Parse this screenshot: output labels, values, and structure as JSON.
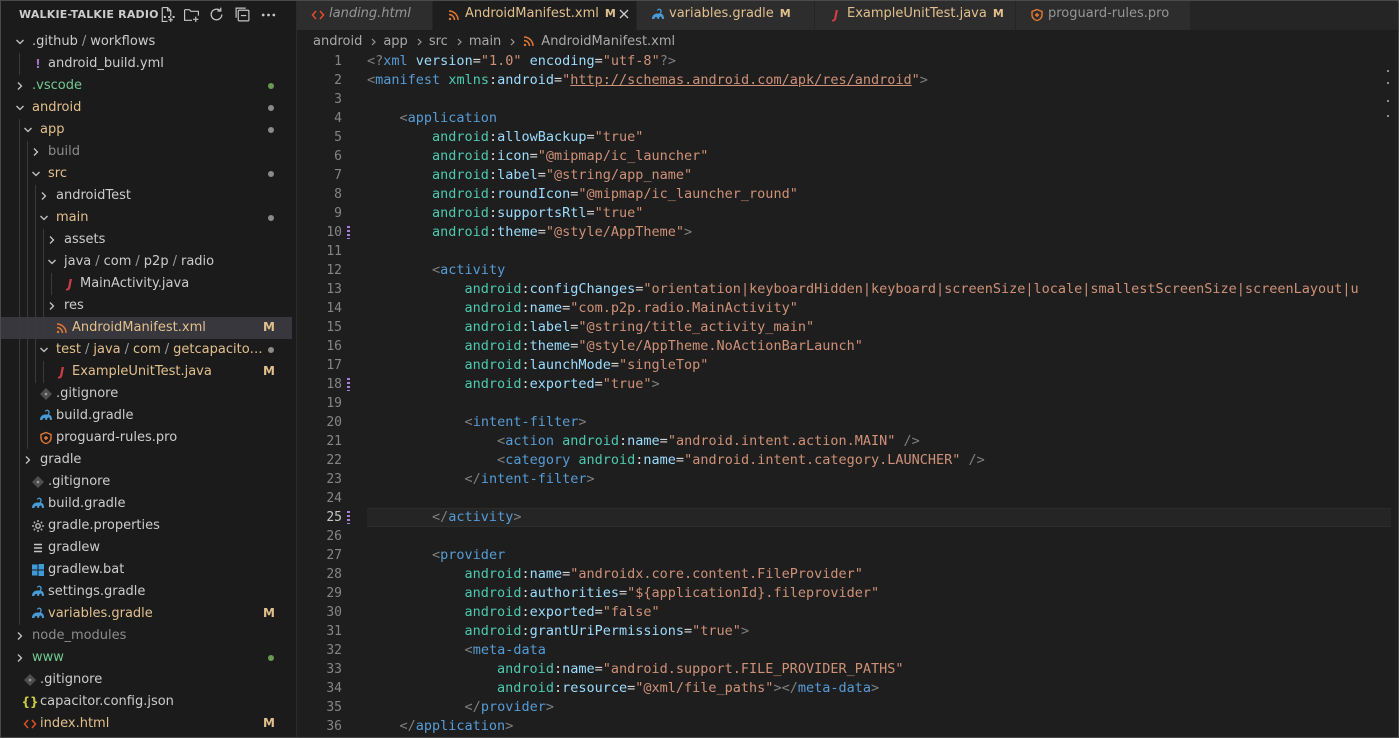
{
  "colors": {
    "tree_default": "#cccccc",
    "tree_modified": "#e2c08d",
    "tree_untracked": "#73c991",
    "tree_ignored": "#8c8c8c",
    "dot_green": "#6a9955",
    "dot_gray": "#8a8a8a",
    "yaml_icon": "#a074c4",
    "java_icon": "#cc3e44",
    "xml_icon": "#e37933",
    "gradle_icon": "#4a9ad6",
    "json_icon": "#cbcb41",
    "html_icon": "#e44d26"
  },
  "sidebar": {
    "title": "WALKIE-TALKIE RADIO ...",
    "actions": [
      {
        "name": "new-file-icon"
      },
      {
        "name": "new-folder-icon"
      },
      {
        "name": "refresh-icon"
      },
      {
        "name": "collapse-all-icon"
      },
      {
        "name": "more-actions-icon"
      }
    ],
    "tree": [
      {
        "parts": [
          ".github",
          "workflows"
        ],
        "depth": 0,
        "chevron": "down",
        "icon": "none",
        "color": "default"
      },
      {
        "parts": [
          "android_build.yml"
        ],
        "depth": 1,
        "chevron": "none",
        "icon": "yaml",
        "glyph": "!",
        "color": "default"
      },
      {
        "parts": [
          ".vscode"
        ],
        "depth": 0,
        "chevron": "right",
        "icon": "none",
        "color": "untracked",
        "dot": "green"
      },
      {
        "parts": [
          "android"
        ],
        "depth": 0,
        "chevron": "down",
        "icon": "none",
        "color": "modified",
        "dot": "gray"
      },
      {
        "parts": [
          "app"
        ],
        "depth": 1,
        "chevron": "down",
        "icon": "none",
        "color": "modified",
        "dot": "gray"
      },
      {
        "parts": [
          "build"
        ],
        "depth": 2,
        "chevron": "right",
        "icon": "none",
        "color": "ignored"
      },
      {
        "parts": [
          "src"
        ],
        "depth": 2,
        "chevron": "down",
        "icon": "none",
        "color": "modified",
        "dot": "gray"
      },
      {
        "parts": [
          "androidTest"
        ],
        "depth": 3,
        "chevron": "right",
        "icon": "none",
        "color": "default"
      },
      {
        "parts": [
          "main"
        ],
        "depth": 3,
        "chevron": "down",
        "icon": "none",
        "color": "modified",
        "dot": "gray"
      },
      {
        "parts": [
          "assets"
        ],
        "depth": 4,
        "chevron": "right",
        "icon": "none",
        "color": "default"
      },
      {
        "parts": [
          "java",
          "com",
          "p2p",
          "radio"
        ],
        "depth": 4,
        "chevron": "down",
        "icon": "none",
        "color": "default"
      },
      {
        "parts": [
          "MainActivity.java"
        ],
        "depth": 5,
        "chevron": "none",
        "icon": "java",
        "glyph": "J",
        "color": "default"
      },
      {
        "parts": [
          "res"
        ],
        "depth": 4,
        "chevron": "right",
        "icon": "none",
        "color": "default"
      },
      {
        "parts": [
          "AndroidManifest.xml"
        ],
        "depth": 4,
        "chevron": "none",
        "icon": "xml",
        "color": "modified",
        "badge": "M",
        "selected": true
      },
      {
        "parts": [
          "test",
          "java",
          "com",
          "getcapacitor",
          "..."
        ],
        "depth": 3,
        "chevron": "down",
        "icon": "none",
        "color": "modified",
        "dot": "gray"
      },
      {
        "parts": [
          "ExampleUnitTest.java"
        ],
        "depth": 4,
        "chevron": "none",
        "icon": "java",
        "glyph": "J",
        "color": "modified",
        "badge": "M"
      },
      {
        "parts": [
          ".gitignore"
        ],
        "depth": 2,
        "chevron": "none",
        "icon": "git",
        "color": "default"
      },
      {
        "parts": [
          "build.gradle"
        ],
        "depth": 2,
        "chevron": "none",
        "icon": "gradle",
        "color": "default"
      },
      {
        "parts": [
          "proguard-rules.pro"
        ],
        "depth": 2,
        "chevron": "none",
        "icon": "proguard",
        "color": "default"
      },
      {
        "parts": [
          "gradle"
        ],
        "depth": 1,
        "chevron": "right",
        "icon": "none",
        "color": "default"
      },
      {
        "parts": [
          ".gitignore"
        ],
        "depth": 1,
        "chevron": "none",
        "icon": "git",
        "color": "default"
      },
      {
        "parts": [
          "build.gradle"
        ],
        "depth": 1,
        "chevron": "none",
        "icon": "gradle",
        "color": "default"
      },
      {
        "parts": [
          "gradle.properties"
        ],
        "depth": 1,
        "chevron": "none",
        "icon": "gear",
        "color": "default"
      },
      {
        "parts": [
          "gradlew"
        ],
        "depth": 1,
        "chevron": "none",
        "icon": "lines",
        "color": "default"
      },
      {
        "parts": [
          "gradlew.bat"
        ],
        "depth": 1,
        "chevron": "none",
        "icon": "windows",
        "color": "default"
      },
      {
        "parts": [
          "settings.gradle"
        ],
        "depth": 1,
        "chevron": "none",
        "icon": "gradle",
        "color": "default"
      },
      {
        "parts": [
          "variables.gradle"
        ],
        "depth": 1,
        "chevron": "none",
        "icon": "gradle",
        "color": "modified",
        "badge": "M"
      },
      {
        "parts": [
          "node_modules"
        ],
        "depth": 0,
        "chevron": "right",
        "icon": "none",
        "color": "ignored"
      },
      {
        "parts": [
          "www"
        ],
        "depth": 0,
        "chevron": "right",
        "icon": "none",
        "color": "untracked",
        "dot": "green"
      },
      {
        "parts": [
          ".gitignore"
        ],
        "depth": 0,
        "chevron": "none",
        "icon": "git",
        "color": "default"
      },
      {
        "parts": [
          "capacitor.config.json"
        ],
        "depth": 0,
        "chevron": "none",
        "icon": "json",
        "glyph": "{}",
        "color": "default"
      },
      {
        "parts": [
          "index.html"
        ],
        "depth": 0,
        "chevron": "none",
        "icon": "html",
        "color": "modified",
        "badge": "M"
      }
    ]
  },
  "tabs": [
    {
      "label": "landing.html",
      "icon": "html",
      "italic": true,
      "color": "#969696",
      "width": 136
    },
    {
      "label": "AndroidManifest.xml",
      "icon": "xml",
      "badge": "M",
      "active": true,
      "color": "#e2c08d",
      "width": 204
    },
    {
      "label": "variables.gradle",
      "icon": "gradle",
      "badge": "M",
      "color": "#e2c08d",
      "width": 178
    },
    {
      "label": "ExampleUnitTest.java",
      "icon": "java",
      "badge": "M",
      "color": "#e2c08d",
      "width": 201
    },
    {
      "label": "proguard-rules.pro",
      "icon": "proguard",
      "color": "#969696",
      "width": 175
    }
  ],
  "breadcrumb": [
    "android",
    "app",
    "src",
    "main",
    "AndroidManifest.xml"
  ],
  "editor": {
    "current_line": 25,
    "modified_lines": [
      10,
      18,
      25
    ],
    "lines": [
      [
        [
          "ta",
          "<?"
        ],
        [
          "tn",
          "xml"
        ],
        [
          "pl",
          " "
        ],
        [
          "an",
          "version"
        ],
        [
          "eq",
          "="
        ],
        [
          "av",
          "\"1.0\""
        ],
        [
          "pl",
          " "
        ],
        [
          "an",
          "encoding"
        ],
        [
          "eq",
          "="
        ],
        [
          "av",
          "\"utf-8\""
        ],
        [
          "ta",
          "?>"
        ]
      ],
      [
        [
          "ta",
          "<"
        ],
        [
          "tn",
          "manifest"
        ],
        [
          "pl",
          " "
        ],
        [
          "ns",
          "xmlns"
        ],
        [
          "eq",
          ":"
        ],
        [
          "an",
          "android"
        ],
        [
          "eq",
          "="
        ],
        [
          "av",
          "\""
        ],
        [
          "url",
          "http://schemas.android.com/apk/res/android"
        ],
        [
          "av",
          "\""
        ],
        [
          "ta",
          ">"
        ]
      ],
      [],
      [
        [
          "pl",
          "    "
        ],
        [
          "ta",
          "<"
        ],
        [
          "tn",
          "application"
        ]
      ],
      [
        [
          "pl",
          "        "
        ],
        [
          "ns",
          "android"
        ],
        [
          "eq",
          ":"
        ],
        [
          "an",
          "allowBackup"
        ],
        [
          "eq",
          "="
        ],
        [
          "av",
          "\"true\""
        ]
      ],
      [
        [
          "pl",
          "        "
        ],
        [
          "ns",
          "android"
        ],
        [
          "eq",
          ":"
        ],
        [
          "an",
          "icon"
        ],
        [
          "eq",
          "="
        ],
        [
          "av",
          "\"@mipmap/ic_launcher\""
        ]
      ],
      [
        [
          "pl",
          "        "
        ],
        [
          "ns",
          "android"
        ],
        [
          "eq",
          ":"
        ],
        [
          "an",
          "label"
        ],
        [
          "eq",
          "="
        ],
        [
          "av",
          "\"@string/app_name\""
        ]
      ],
      [
        [
          "pl",
          "        "
        ],
        [
          "ns",
          "android"
        ],
        [
          "eq",
          ":"
        ],
        [
          "an",
          "roundIcon"
        ],
        [
          "eq",
          "="
        ],
        [
          "av",
          "\"@mipmap/ic_launcher_round\""
        ]
      ],
      [
        [
          "pl",
          "        "
        ],
        [
          "ns",
          "android"
        ],
        [
          "eq",
          ":"
        ],
        [
          "an",
          "supportsRtl"
        ],
        [
          "eq",
          "="
        ],
        [
          "av",
          "\"true\""
        ]
      ],
      [
        [
          "pl",
          "        "
        ],
        [
          "ns",
          "android"
        ],
        [
          "eq",
          ":"
        ],
        [
          "an",
          "theme"
        ],
        [
          "eq",
          "="
        ],
        [
          "av",
          "\"@style/AppTheme\""
        ],
        [
          "ta",
          ">"
        ]
      ],
      [],
      [
        [
          "pl",
          "        "
        ],
        [
          "ta",
          "<"
        ],
        [
          "tn",
          "activity"
        ]
      ],
      [
        [
          "pl",
          "            "
        ],
        [
          "ns",
          "android"
        ],
        [
          "eq",
          ":"
        ],
        [
          "an",
          "configChanges"
        ],
        [
          "eq",
          "="
        ],
        [
          "av",
          "\"orientation|keyboardHidden|keyboard|screenSize|locale|smallestScreenSize|screenLayout|u"
        ]
      ],
      [
        [
          "pl",
          "            "
        ],
        [
          "ns",
          "android"
        ],
        [
          "eq",
          ":"
        ],
        [
          "an",
          "name"
        ],
        [
          "eq",
          "="
        ],
        [
          "av",
          "\"com.p2p.radio.MainActivity\""
        ]
      ],
      [
        [
          "pl",
          "            "
        ],
        [
          "ns",
          "android"
        ],
        [
          "eq",
          ":"
        ],
        [
          "an",
          "label"
        ],
        [
          "eq",
          "="
        ],
        [
          "av",
          "\"@string/title_activity_main\""
        ]
      ],
      [
        [
          "pl",
          "            "
        ],
        [
          "ns",
          "android"
        ],
        [
          "eq",
          ":"
        ],
        [
          "an",
          "theme"
        ],
        [
          "eq",
          "="
        ],
        [
          "av",
          "\"@style/AppTheme.NoActionBarLaunch\""
        ]
      ],
      [
        [
          "pl",
          "            "
        ],
        [
          "ns",
          "android"
        ],
        [
          "eq",
          ":"
        ],
        [
          "an",
          "launchMode"
        ],
        [
          "eq",
          "="
        ],
        [
          "av",
          "\"singleTop\""
        ]
      ],
      [
        [
          "pl",
          "            "
        ],
        [
          "ns",
          "android"
        ],
        [
          "eq",
          ":"
        ],
        [
          "an",
          "exported"
        ],
        [
          "eq",
          "="
        ],
        [
          "av",
          "\"true\""
        ],
        [
          "ta",
          ">"
        ]
      ],
      [],
      [
        [
          "pl",
          "            "
        ],
        [
          "ta",
          "<"
        ],
        [
          "tn",
          "intent-filter"
        ],
        [
          "ta",
          ">"
        ]
      ],
      [
        [
          "pl",
          "                "
        ],
        [
          "ta",
          "<"
        ],
        [
          "tn",
          "action"
        ],
        [
          "pl",
          " "
        ],
        [
          "ns",
          "android"
        ],
        [
          "eq",
          ":"
        ],
        [
          "an",
          "name"
        ],
        [
          "eq",
          "="
        ],
        [
          "av",
          "\"android.intent.action.MAIN\""
        ],
        [
          "pl",
          " "
        ],
        [
          "ta",
          "/>"
        ]
      ],
      [
        [
          "pl",
          "                "
        ],
        [
          "ta",
          "<"
        ],
        [
          "tn",
          "category"
        ],
        [
          "pl",
          " "
        ],
        [
          "ns",
          "android"
        ],
        [
          "eq",
          ":"
        ],
        [
          "an",
          "name"
        ],
        [
          "eq",
          "="
        ],
        [
          "av",
          "\"android.intent.category.LAUNCHER\""
        ],
        [
          "pl",
          " "
        ],
        [
          "ta",
          "/>"
        ]
      ],
      [
        [
          "pl",
          "            "
        ],
        [
          "ta",
          "</"
        ],
        [
          "tn",
          "intent-filter"
        ],
        [
          "ta",
          ">"
        ]
      ],
      [],
      [
        [
          "pl",
          "        "
        ],
        [
          "ta",
          "</"
        ],
        [
          "tn",
          "activity"
        ],
        [
          "ta",
          ">"
        ]
      ],
      [],
      [
        [
          "pl",
          "        "
        ],
        [
          "ta",
          "<"
        ],
        [
          "tn",
          "provider"
        ]
      ],
      [
        [
          "pl",
          "            "
        ],
        [
          "ns",
          "android"
        ],
        [
          "eq",
          ":"
        ],
        [
          "an",
          "name"
        ],
        [
          "eq",
          "="
        ],
        [
          "av",
          "\"androidx.core.content.FileProvider\""
        ]
      ],
      [
        [
          "pl",
          "            "
        ],
        [
          "ns",
          "android"
        ],
        [
          "eq",
          ":"
        ],
        [
          "an",
          "authorities"
        ],
        [
          "eq",
          "="
        ],
        [
          "av",
          "\"${applicationId}.fileprovider\""
        ]
      ],
      [
        [
          "pl",
          "            "
        ],
        [
          "ns",
          "android"
        ],
        [
          "eq",
          ":"
        ],
        [
          "an",
          "exported"
        ],
        [
          "eq",
          "="
        ],
        [
          "av",
          "\"false\""
        ]
      ],
      [
        [
          "pl",
          "            "
        ],
        [
          "ns",
          "android"
        ],
        [
          "eq",
          ":"
        ],
        [
          "an",
          "grantUriPermissions"
        ],
        [
          "eq",
          "="
        ],
        [
          "av",
          "\"true\""
        ],
        [
          "ta",
          ">"
        ]
      ],
      [
        [
          "pl",
          "            "
        ],
        [
          "ta",
          "<"
        ],
        [
          "tn",
          "meta-data"
        ]
      ],
      [
        [
          "pl",
          "                "
        ],
        [
          "ns",
          "android"
        ],
        [
          "eq",
          ":"
        ],
        [
          "an",
          "name"
        ],
        [
          "eq",
          "="
        ],
        [
          "av",
          "\"android.support.FILE_PROVIDER_PATHS\""
        ]
      ],
      [
        [
          "pl",
          "                "
        ],
        [
          "ns",
          "android"
        ],
        [
          "eq",
          ":"
        ],
        [
          "an",
          "resource"
        ],
        [
          "eq",
          "="
        ],
        [
          "av",
          "\"@xml/file_paths\""
        ],
        [
          "ta",
          "></"
        ],
        [
          "tn",
          "meta-data"
        ],
        [
          "ta",
          ">"
        ]
      ],
      [
        [
          "pl",
          "            "
        ],
        [
          "ta",
          "</"
        ],
        [
          "tn",
          "provider"
        ],
        [
          "ta",
          ">"
        ]
      ],
      [
        [
          "pl",
          "    "
        ],
        [
          "ta",
          "</"
        ],
        [
          "tn",
          "application"
        ],
        [
          "ta",
          ">"
        ]
      ]
    ]
  }
}
